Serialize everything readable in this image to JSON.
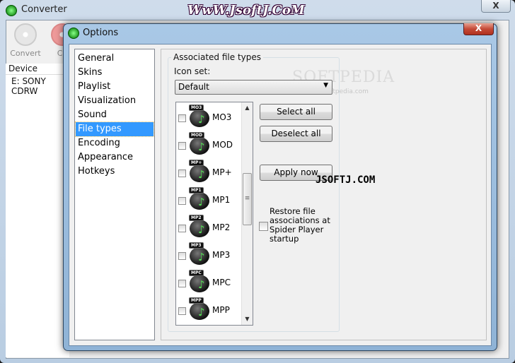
{
  "main_window": {
    "title": "Converter",
    "close_label": "X",
    "toolbar": [
      {
        "label": "Convert",
        "icon": "disc-icon"
      },
      {
        "label": "Ca",
        "icon": "cancel-icon"
      }
    ],
    "device_header": "Device",
    "device_row": "E: SONY CDRW"
  },
  "watermarks": {
    "top": "WwW.JsoftJ.CoM",
    "softpedia": "SOFTPEDIA",
    "softpedia_url": "www.softpedia.com",
    "center": "JSOFTJ.COM"
  },
  "dialog": {
    "title": "Options",
    "close_label": "X",
    "nav": [
      {
        "label": "General"
      },
      {
        "label": "Skins"
      },
      {
        "label": "Playlist"
      },
      {
        "label": "Visualization"
      },
      {
        "label": "Sound"
      },
      {
        "label": "File types",
        "selected": true
      },
      {
        "label": "Encoding"
      },
      {
        "label": "Appearance"
      },
      {
        "label": "Hotkeys"
      }
    ],
    "group_title": "Associated file types",
    "icon_set_label": "Icon set:",
    "icon_set_value": "Default",
    "file_types": [
      {
        "name": "MO3",
        "checked": false
      },
      {
        "name": "MOD",
        "checked": false
      },
      {
        "name": "MP+",
        "checked": false
      },
      {
        "name": "MP1",
        "checked": false
      },
      {
        "name": "MP2",
        "checked": false
      },
      {
        "name": "MP3",
        "checked": false
      },
      {
        "name": "MPC",
        "checked": false
      },
      {
        "name": "MPP",
        "checked": false
      }
    ],
    "buttons": {
      "select_all": "Select all",
      "deselect_all": "Deselect all",
      "apply_now": "Apply now"
    },
    "restore_label": "Restore file associations at Spider Player startup",
    "restore_checked": false,
    "colors": {
      "selection": "#3399ff",
      "close_red": "#c44a36"
    }
  }
}
